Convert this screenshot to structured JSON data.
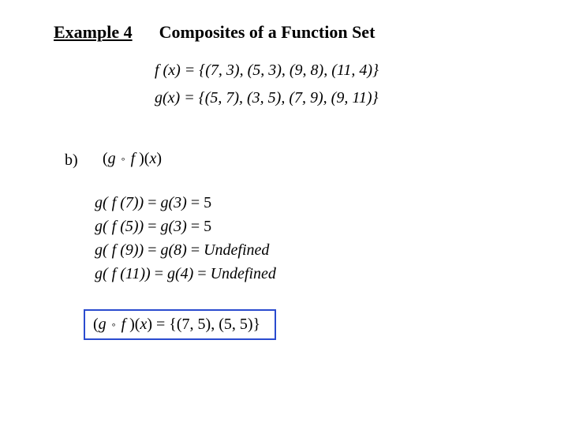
{
  "header": {
    "example_label": "Example 4",
    "title": "Composites of a Function Set"
  },
  "definitions": {
    "f": "f (x) = {(7, 3), (5, 3), (9, 8), (11, 4)}",
    "g": "g(x) = {(5, 7), (3, 5), (7, 9), (9, 11)}"
  },
  "part": {
    "label": "b)",
    "composition_lhs": "(g ∘ f )(x)"
  },
  "work": {
    "l1_lhs": "g( f (7))",
    "l1_mid": "g(3)",
    "l1_rhs": "5",
    "l2_lhs": "g( f (5))",
    "l2_mid": "g(3)",
    "l2_rhs": "5",
    "l3_lhs": "g( f (9))",
    "l3_mid": "g(8)",
    "l3_rhs": "Undefined",
    "l4_lhs": "g( f (11))",
    "l4_mid": "g(4)",
    "l4_rhs": "Undefined"
  },
  "result": {
    "lhs": "(g ∘ f )(x)",
    "rhs": "{(7, 5), (5, 5)}"
  }
}
